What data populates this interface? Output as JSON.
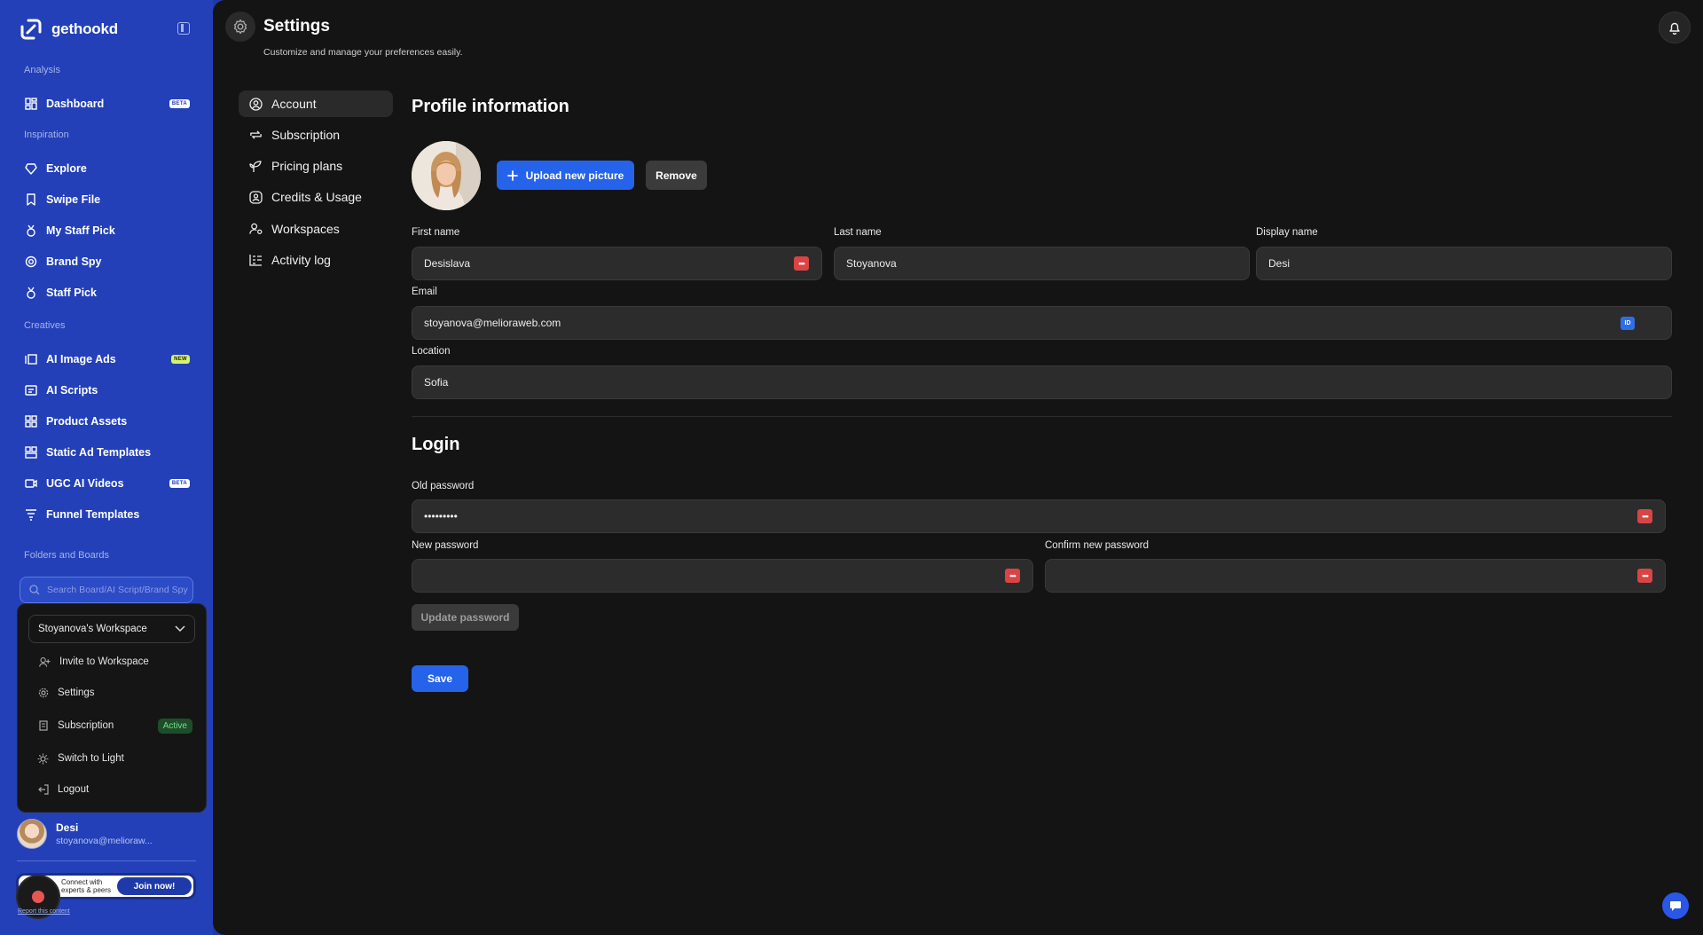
{
  "brand": {
    "name": "gethookd"
  },
  "sidebar": {
    "analysis_label": "Analysis",
    "inspiration_label": "Inspiration",
    "creatives_label": "Creatives",
    "folders_label": "Folders and Boards",
    "items": [
      {
        "label": "Dashboard",
        "badge": "BETA"
      },
      {
        "label": "Explore"
      },
      {
        "label": "Swipe File"
      },
      {
        "label": "My Staff Pick"
      },
      {
        "label": "Brand Spy"
      },
      {
        "label": "Staff Pick"
      },
      {
        "label": "AI Image Ads",
        "badge": "NEW"
      },
      {
        "label": "AI Scripts"
      },
      {
        "label": "Product Assets"
      },
      {
        "label": "Static Ad Templates"
      },
      {
        "label": "UGC AI Videos",
        "badge": "BETA"
      },
      {
        "label": "Funnel Templates"
      }
    ],
    "search_placeholder": "Search Board/AI Script/Brand Spy"
  },
  "workspace_menu": {
    "workspace_name": "Stoyanova's Workspace",
    "items": [
      {
        "label": "Invite to Workspace"
      },
      {
        "label": "Settings"
      },
      {
        "label": "Subscription",
        "badge": "Active"
      },
      {
        "label": "Switch to Light"
      },
      {
        "label": "Logout"
      }
    ]
  },
  "user": {
    "name": "Desi",
    "email": "stoyanova@melioraw..."
  },
  "banner": {
    "text": "Connect with experts & peers",
    "join_label": "Join now!",
    "report_link": "Report this content"
  },
  "header": {
    "title": "Settings",
    "subtitle": "Customize and manage your preferences easily."
  },
  "settings_nav": [
    {
      "label": "Account",
      "active": true
    },
    {
      "label": "Subscription"
    },
    {
      "label": "Pricing plans"
    },
    {
      "label": "Credits & Usage"
    },
    {
      "label": "Workspaces"
    },
    {
      "label": "Activity log"
    }
  ],
  "profile": {
    "title": "Profile information",
    "upload_label": "Upload new picture",
    "remove_label": "Remove",
    "first_name_label": "First name",
    "first_name": "Desislava",
    "last_name_label": "Last name",
    "last_name": "Stoyanova",
    "display_name_label": "Display name",
    "display_name": "Desi",
    "email_label": "Email",
    "email": "stoyanova@melioraweb.com",
    "location_label": "Location",
    "location": "Sofia"
  },
  "login": {
    "title": "Login",
    "old_password_label": "Old password",
    "old_password": "•••••••••",
    "new_password_label": "New password",
    "confirm_password_label": "Confirm new password",
    "update_label": "Update password"
  },
  "save_label": "Save",
  "colors": {
    "accent": "#2563eb",
    "sidebar": "#2340b8",
    "main_bg": "#141414"
  }
}
